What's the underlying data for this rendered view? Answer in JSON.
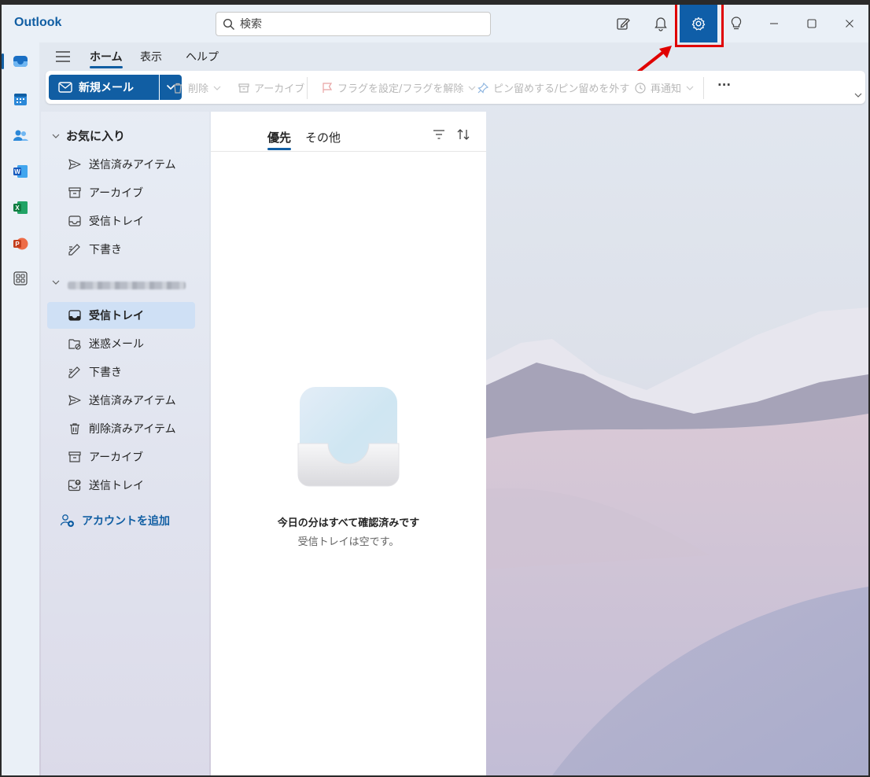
{
  "app": {
    "title": "Outlook"
  },
  "search": {
    "placeholder": "検索"
  },
  "titlebar": {
    "icons": [
      "compose-note-icon",
      "bell-icon",
      "gear-icon",
      "lightbulb-icon",
      "minimize-icon",
      "maximize-icon",
      "close-icon"
    ]
  },
  "rail": {
    "items": [
      "mail-icon",
      "calendar-icon",
      "people-icon",
      "word-icon",
      "excel-icon",
      "powerpoint-icon",
      "apps-icon"
    ]
  },
  "ribbon": {
    "tabs": [
      {
        "label": "ホーム",
        "active": true
      },
      {
        "label": "表示"
      },
      {
        "label": "ヘルプ"
      }
    ],
    "new_mail": "新規メール",
    "delete": "削除",
    "archive": "アーカイブ",
    "flag": "フラグを設定/フラグを解除",
    "pin": "ピン留めする/ピン留めを外す",
    "snooze": "再通知",
    "more": "···"
  },
  "folders": {
    "favorites_label": "お気に入り",
    "favorites": [
      "送信済みアイテム",
      "アーカイブ",
      "受信トレイ",
      "下書き"
    ],
    "account_items": [
      "受信トレイ",
      "迷惑メール",
      "下書き",
      "送信済みアイテム",
      "削除済みアイテム",
      "アーカイブ",
      "送信トレイ"
    ],
    "add_account": "アカウントを追加"
  },
  "message_list": {
    "tabs": [
      "優先",
      "その他"
    ],
    "empty_title": "今日の分はすべて確認済みです",
    "empty_subtitle": "受信トレイは空です。"
  },
  "colors": {
    "accent": "#115ea3",
    "highlight_frame": "#e00000",
    "settings_bg": "#0f5ea8"
  }
}
